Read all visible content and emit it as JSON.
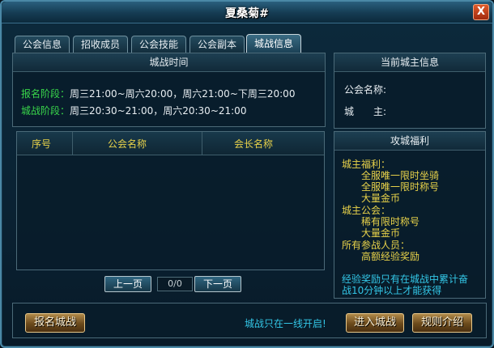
{
  "window": {
    "title": "夏桑菊#",
    "close_label": "X"
  },
  "tabs": [
    {
      "label": "公会信息"
    },
    {
      "label": "招收成员"
    },
    {
      "label": "公会技能"
    },
    {
      "label": "公会副本"
    },
    {
      "label": "城战信息",
      "active": true
    }
  ],
  "battle_time": {
    "heading": "城战时间",
    "signup_label": "报名阶段：",
    "signup_time": "周三21:00~周六20:00，周六21:00~下周三20:00",
    "battle_label": "城战阶段：",
    "battle_time": "周三20:30~21:00，周六20:30~21:00"
  },
  "table": {
    "columns": [
      "序号",
      "公会名称",
      "会长名称"
    ],
    "rows": []
  },
  "pager": {
    "prev_label": "上一页",
    "page": "0/0",
    "next_label": "下一页"
  },
  "owner_info": {
    "heading": "当前城主信息",
    "guild_label": "公会名称:",
    "lord_label": "城　　主:"
  },
  "rewards": {
    "heading": "攻城福利",
    "lines": [
      "城主福利：",
      "全服唯一限时坐骑",
      "全服唯一限时称号",
      "大量金币",
      "城主公会：",
      "稀有限时称号",
      "大量金币",
      "所有参战人员：",
      "高额经验奖励"
    ],
    "note_line1": "经验奖励只有在城战中累计奋",
    "note_line2": "战10分钟以上才能获得"
  },
  "bottom": {
    "signup_button": "报名城战",
    "hint": "城战只在一线开启!",
    "enter_button": "进入城战",
    "rules_button": "规则介绍"
  }
}
